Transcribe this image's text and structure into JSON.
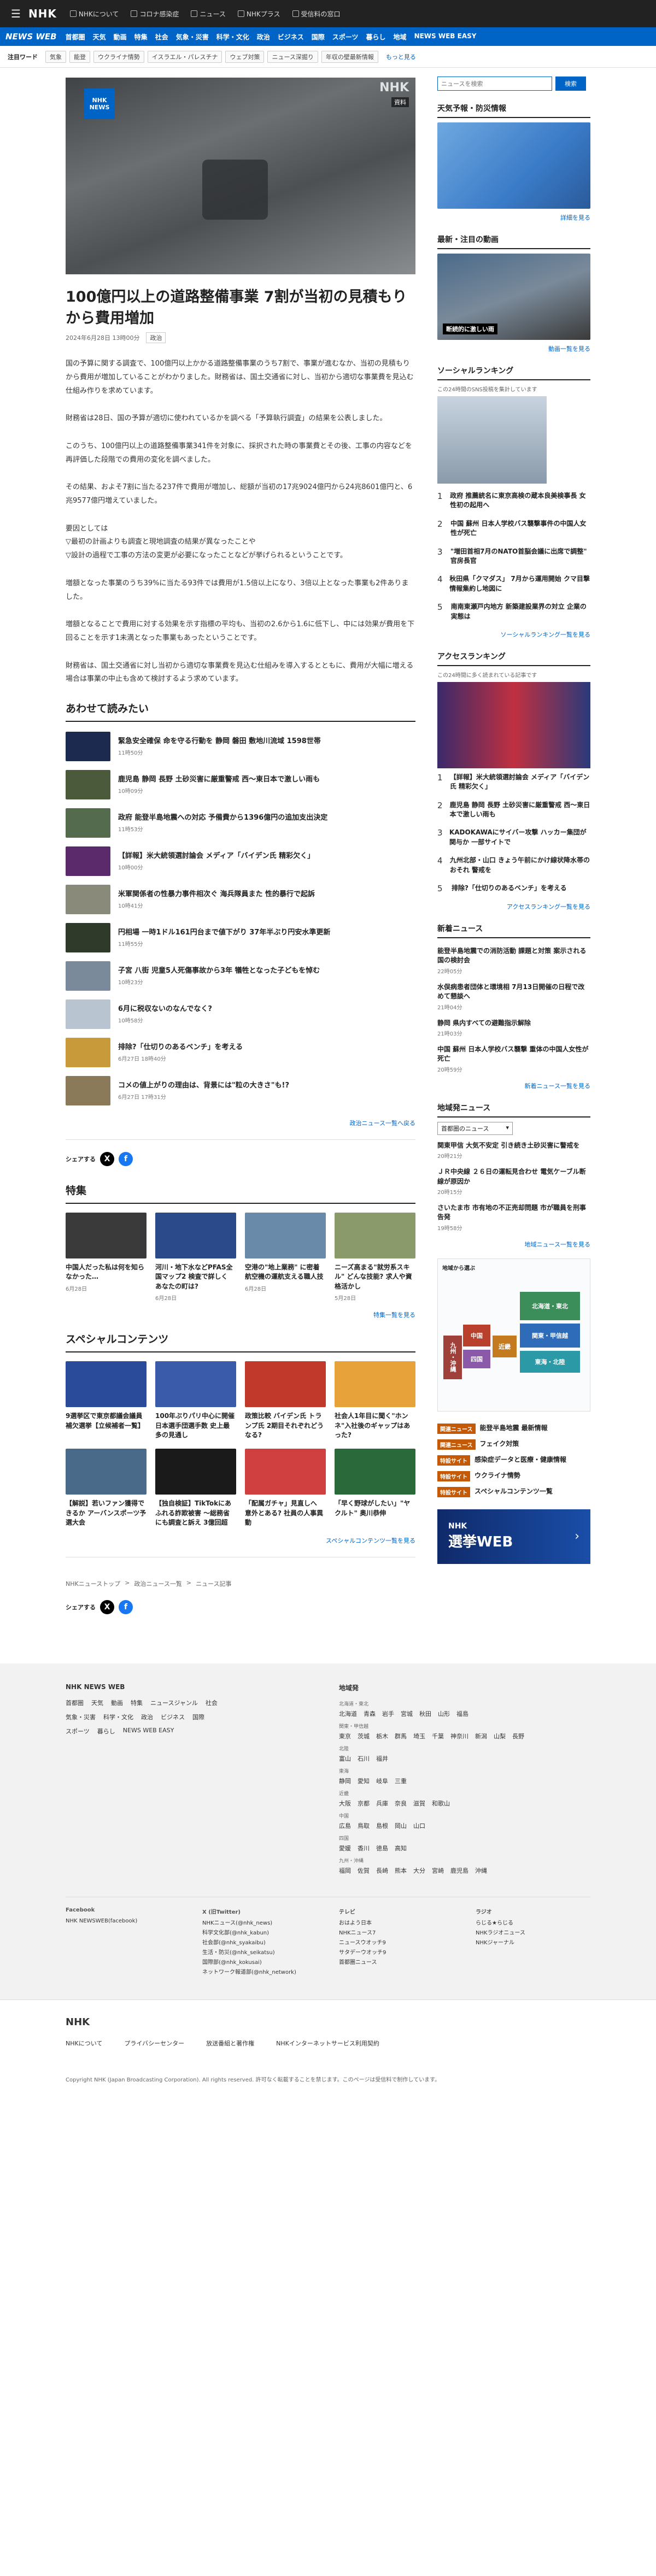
{
  "topbar": {
    "menu_icon": "hamburger-icon",
    "logo": "NHK",
    "nav": [
      "NHKについて",
      "コロナ感染症",
      "ニュース",
      "NHKプラス",
      "受信料の窓口"
    ]
  },
  "bluenav": {
    "brand": "NEWS WEB",
    "items": [
      "首都圏",
      "天気",
      "動画",
      "特集",
      "社会",
      "気象・災害",
      "科学・文化",
      "政治",
      "ビジネス",
      "国際",
      "スポーツ",
      "暮らし",
      "地域",
      "NEWS WEB EASY"
    ]
  },
  "keywords": {
    "label": "注目ワード",
    "chips": [
      "気象",
      "能登",
      "ウクライナ情勢",
      "イスラエル・パレスチナ",
      "ウェブ対策",
      "ニュース深掘り",
      "年収の壁最新情報"
    ],
    "more": "もっと見る"
  },
  "article": {
    "hero": {
      "badge_line1": "NHK",
      "badge_line2": "NEWS",
      "watermark": "NHK",
      "tag": "資料"
    },
    "title": "100億円以上の道路整備事業 7割が当初の見積もりから費用増加",
    "date": "2024年6月28日 13時00分",
    "category": "政治",
    "paragraphs": [
      "国の予算に関する調査で、100億円以上かかる道路整備事業のうち7割で、事業が進むなか、当初の見積もりから費用が増加していることがわかりました。財務省は、国土交通省に対し、当初から適切な事業費を見込む仕組み作りを求めています。",
      "財務省は28日、国の予算が適切に使われているかを調べる「予算執行調査」の結果を公表しました。",
      "このうち、100億円以上の道路整備事業341件を対象に、採択された時の事業費とその後、工事の内容などを再評価した段階での費用の変化を調べました。",
      "その結果、およそ7割に当たる237件で費用が増加し、総額が当初の17兆9024億円から24兆8601億円と、6兆9577億円増えていました。",
      "要因としては\n▽最初の計画よりも調査と現地調査の結果が異なったことや\n▽設計の過程で工事の方法の変更が必要になったことなどが挙げられるということです。",
      "増額となった事業のうち39%に当たる93件では費用が1.5倍以上になり、3倍以上となった事業も2件ありました。",
      "増額となることで費用に対する効果を示す指標の平均も、当初の2.6から1.6に低下し、中には効果が費用を下回ることを示す1未満となった事業もあったということです。",
      "財務省は、国土交通省に対し当初から適切な事業費を見込む仕組みを導入するとともに、費用が大幅に増える場合は事業の中止も含めて検討するよう求めています。"
    ]
  },
  "related": {
    "heading": "あわせて読みたい",
    "items": [
      {
        "title": "緊急安全確保 命を守る行動を 静岡 磐田 敷地川流域 1598世帯",
        "date": "11時50分",
        "color": "#1c2a4f"
      },
      {
        "title": "鹿児島 静岡 長野 土砂災害に厳重警戒 西〜東日本で激しい雨も",
        "date": "10時09分",
        "color": "#4a5a3a"
      },
      {
        "title": "政府 能登半島地震への対応 予備費から1396億円の追加支出決定",
        "date": "11時53分",
        "color": "#556b4d"
      },
      {
        "title": "【詳報】米大統領選討論会 メディア「バイデン氏 精彩欠く」",
        "date": "10時00分",
        "color": "#5a2a6a"
      },
      {
        "title": "米軍関係者の性暴力事件相次ぐ 海兵隊員また 性的暴行で起訴",
        "date": "10時41分",
        "color": "#8a8a7a"
      },
      {
        "title": "円相場 一時1ドル161円台まで値下がり 37年半ぶり円安水準更新",
        "date": "11時55分",
        "color": "#2f3a2a"
      },
      {
        "title": "子宮 八街 児童5人死傷事故から3年 犠牲となった子どもを悼む",
        "date": "10時23分",
        "color": "#7a8a9a"
      },
      {
        "title": "6月に税収ないのなんでなく?",
        "date": "10時58分",
        "color": "#b8c4d0"
      },
      {
        "title": "排除?「仕切りのあるベンチ」を考える",
        "date": "6月27日 18時40分",
        "color": "#c89a3a"
      },
      {
        "title": "コメの値上がりの理由は、背景には\"粒の大きさ\"も!?",
        "date": "6月27日 17時31分",
        "color": "#8a7a5a"
      }
    ],
    "more": "政治ニュース一覧へ戻る"
  },
  "share": {
    "label": "シェアする",
    "x": "X",
    "fb": "f"
  },
  "features": {
    "heading": "特集",
    "items": [
      {
        "title": "中国人だった私は何を知らなかった…",
        "date": "6月28日",
        "color": "#3a3a3a"
      },
      {
        "title": "河川・地下水などPFAS全国マップ2 検査で詳しく あなたの町は?",
        "date": "6月28日",
        "color": "#2a4a8a"
      },
      {
        "title": "空港の\"地上業務\" に密着 航空機の運航支える職人技",
        "date": "6月28日",
        "color": "#6a8aaa"
      },
      {
        "title": "ニーズ高まる\"就労系スキル\" どんな技能? 求人や資格活かし",
        "date": "5月28日",
        "color": "#8a9a6a"
      }
    ],
    "more": "特集一覧を見る"
  },
  "special": {
    "heading": "スペシャルコンテンツ",
    "items": [
      {
        "title": "9選挙区で東京都議会議員補欠選挙【立候補者一覧】",
        "color": "#2a4a9a"
      },
      {
        "title": "100年ぶりパリ中心に開催 日本選手団選手数 史上最多の見通し",
        "color": "#3a5aaa"
      },
      {
        "title": "政策比較 バイデン氏 トランプ氏 2期目それぞれどうなる?",
        "color": "#c0392b"
      },
      {
        "title": "社会人1年目に聞く\"ホンネ\"入社後のギャップはあった?",
        "color": "#e8a23a"
      },
      {
        "title": "【解説】若いファン獲得できるか アーバンスポーツ予選大会",
        "color": "#4a6a8a"
      },
      {
        "title": "【独自検証】TikTokにあふれる詐欺被害 ～総務省にも調査と訴え 3億回超",
        "color": "#1a1a1a"
      },
      {
        "title": "「配属ガチャ」見直しへ 意外とある? 社員の人事異動",
        "color": "#d04040"
      },
      {
        "title": "「早く野球がしたい」\"ヤクルト\" 奥川恭伸",
        "color": "#2a6a3a"
      }
    ],
    "more": "スペシャルコンテンツ一覧を見る"
  },
  "breadcrumb": [
    "NHKニューストップ",
    "政治ニュース一覧",
    "ニュース記事"
  ],
  "side": {
    "search_placeholder": "ニュースを検索",
    "search_button": "検索",
    "weather": {
      "heading": "天気予報・防災情報",
      "link": "詳細を見る"
    },
    "video": {
      "heading": "最新・注目の動画",
      "caption": "断続的に激しい雨",
      "link": "動画一覧を見る"
    },
    "social": {
      "heading": "ソーシャルランキング",
      "sub": "この24時間のSNS投稿を集計しています",
      "items": [
        "政府 推薦統名に東京高検の蔵本良美検事長 女性初の起用へ",
        "中国 蘇州 日本人学校バス襲撃事件の中国人女性が死亡",
        "\"増田首相7月のNATO首脳会議に出席で調整\" 官房長官",
        "秋田県「クマダス」 7月から運用開始 クマ目撃情報集約し地図に",
        "南南東瀬戸内地方 新築建設業界の対立 企業の実態は"
      ],
      "link": "ソーシャルランキング一覧を見る"
    },
    "access": {
      "heading": "アクセスランキング",
      "sub": "この24時間に多く読まれている記事です",
      "items": [
        "【詳報】米大統領選討論会 メディア「バイデン氏 精彩欠く」",
        "鹿児島 静岡 長野 土砂災害に厳重警戒 西〜東日本で激しい雨も",
        "KADOKAWAにサイバー攻撃 ハッカー集団が関与か 一部サイトで",
        "九州北部・山口 きょう午前にかけ線状降水帯のおそれ 警戒を",
        "排除?「仕切りのあるベンチ」を考える"
      ],
      "link": "アクセスランキング一覧を見る"
    },
    "latest": {
      "heading": "新着ニュース",
      "items": [
        {
          "title": "能登半島地震での消防活動 課題と対策 案示される 国の検討会",
          "date": "22時05分"
        },
        {
          "title": "水俣病患者団体と環境相 7月13日開催の日程で改めて懇談へ",
          "date": "21時04分"
        },
        {
          "title": "静岡 県内すべての避難指示解除",
          "date": "21時03分"
        },
        {
          "title": "中国 蘇州 日本人学校バス襲撃 重体の中国人女性が死亡",
          "date": "20時59分"
        }
      ],
      "link": "新着ニュース一覧を見る"
    },
    "local": {
      "heading": "地域発ニュース",
      "select": "首都圏のニュース",
      "items": [
        {
          "title": "関東甲信 大気不安定 引き続き土砂災害に警戒を",
          "date": "20時21分"
        },
        {
          "title": "ＪＲ中央線 ２６日の運転見合わせ 電気ケーブル断線が原因か",
          "date": "20時15分"
        },
        {
          "title": "さいたま市 市有地の不正売却問題 市が職員を刑事告発",
          "date": "19時58分"
        }
      ],
      "link": "地域ニュース一覧を見る"
    },
    "map": {
      "title": "地域から選ぶ",
      "regions": [
        "北海道・東北",
        "関東・甲信越",
        "東海・北陸",
        "近畿",
        "中国",
        "四国",
        "九州・沖縄"
      ]
    },
    "tags": [
      {
        "label": "関連ニュース",
        "text": "能登半島地震 最新情報"
      },
      {
        "label": "関連ニュース",
        "text": "フェイク対策"
      },
      {
        "label": "特設サイト",
        "text": "感染症データと医療・健康情報"
      },
      {
        "label": "特設サイト",
        "text": "ウクライナ情勢"
      },
      {
        "label": "特設サイト",
        "text": "スペシャルコンテンツ一覧"
      }
    ],
    "election": {
      "line1": "NHK",
      "line2": "選挙WEB"
    }
  },
  "footer": {
    "left_heading": "NHK NEWS WEB",
    "left_links": [
      "首都圏",
      "天気",
      "動画",
      "特集",
      "ニュースジャンル",
      "社会",
      "気象・災害",
      "科学・文化",
      "政治",
      "ビジネス",
      "国際",
      "スポーツ",
      "暮らし",
      "NEWS WEB EASY"
    ],
    "region_heading": "地域発",
    "regions": [
      {
        "group": "北海道・東北",
        "names": [
          "北海道",
          "青森",
          "岩手",
          "宮城",
          "秋田",
          "山形",
          "福島"
        ]
      },
      {
        "group": "関東・甲信越",
        "names": [
          "東京",
          "茨城",
          "栃木",
          "群馬",
          "埼玉",
          "千葉",
          "神奈川",
          "新潟",
          "山梨",
          "長野"
        ]
      },
      {
        "group": "北陸",
        "names": [
          "富山",
          "石川",
          "福井"
        ]
      },
      {
        "group": "東海",
        "names": [
          "静岡",
          "愛知",
          "岐阜",
          "三重"
        ]
      },
      {
        "group": "近畿",
        "names": [
          "大阪",
          "京都",
          "兵庫",
          "奈良",
          "滋賀",
          "和歌山"
        ]
      },
      {
        "group": "中国",
        "names": [
          "広島",
          "鳥取",
          "島根",
          "岡山",
          "山口"
        ]
      },
      {
        "group": "四国",
        "names": [
          "愛媛",
          "香川",
          "徳島",
          "高知"
        ]
      },
      {
        "group": "九州・沖縄",
        "names": [
          "福岡",
          "佐賀",
          "長崎",
          "熊本",
          "大分",
          "宮崎",
          "鹿児島",
          "沖縄"
        ]
      }
    ],
    "sns": [
      {
        "h": "Facebook",
        "items": [
          "NHK NEWSWEB(facebook)"
        ]
      },
      {
        "h": "X (旧Twitter)",
        "items": [
          "NHKニュース(@nhk_news)",
          "科学文化部(@nhk_kabun)",
          "社会部(@nhk_syakaibu)",
          "生活・防災(@nhk_seikatsu)",
          "国際部(@nhk_kokusai)",
          "ネットワーク報道部(@nhk_network)"
        ]
      },
      {
        "h": "テレビ",
        "items": [
          "おはよう日本",
          "NHKニュース7",
          "ニュースウオッチ9",
          "サタデーウオッチ9",
          "首都圏ニュース"
        ]
      },
      {
        "h": "ラジオ",
        "items": [
          "らじる★らじる",
          "NHKラジオニュース",
          "NHKジャーナル"
        ]
      }
    ],
    "logo": "NHK",
    "bottom_links": [
      "NHKについて",
      "プライバシーセンター",
      "放送番組と著作権",
      "NHKインターネットサービス利用契約"
    ],
    "copyright": "Copyright NHK (Japan Broadcasting Corporation). All rights reserved. 許可なく転載することを禁じます。このページは受信料で制作しています。"
  }
}
